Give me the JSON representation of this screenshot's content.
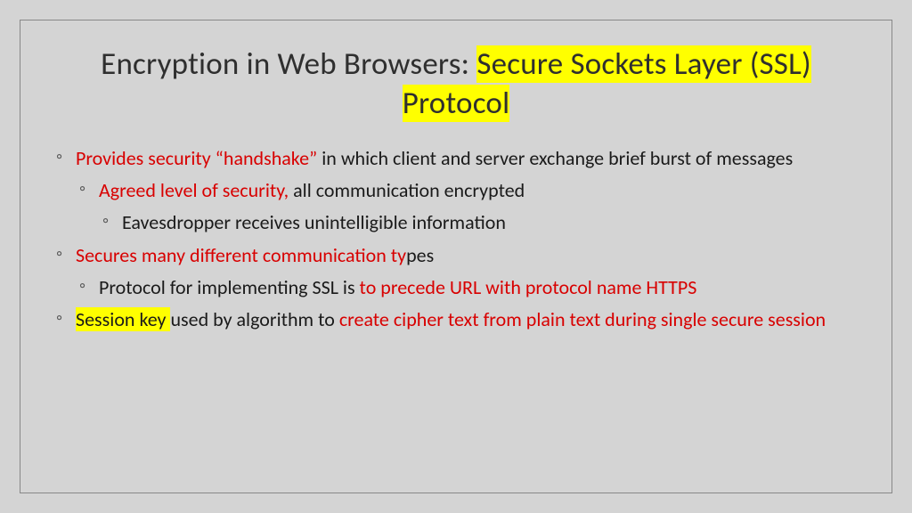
{
  "title": {
    "plain": "Encryption in Web Browsers: ",
    "highlighted": "Secure Sockets Layer (SSL) Protocol"
  },
  "bullets": {
    "b1": {
      "red": "Provides security “handshake” ",
      "rest": "in which client and server exchange brief burst of messages"
    },
    "b1a": {
      "red": "Agreed level of security, ",
      "rest": "all communication encrypted"
    },
    "b1a1": {
      "text": "Eavesdropper receives unintelligible information"
    },
    "b2": {
      "red": "Secures many different communication ty",
      "rest": "pes"
    },
    "b2a": {
      "pre": "Protocol for implementing SSL is ",
      "red": "to precede URL with protocol name HTTPS"
    },
    "b3": {
      "hl": "Session key ",
      "mid": "used by algorithm to ",
      "red": "create cipher text from plain text during single secure session"
    }
  }
}
